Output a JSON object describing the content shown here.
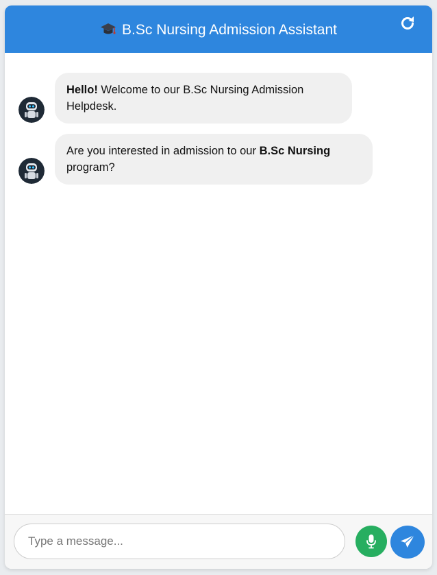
{
  "header": {
    "title": "B.Sc Nursing Admission Assistant",
    "title_icon": "graduation-cap-icon",
    "refresh_icon": "refresh-icon",
    "background_color": "#2e86de"
  },
  "messages": [
    {
      "sender": "bot",
      "avatar_icon": "robot-avatar-icon",
      "parts": [
        {
          "text": "Hello!",
          "bold": true
        },
        {
          "text": " Welcome to our B.Sc Nursing Admission Helpdesk.",
          "bold": false
        }
      ]
    },
    {
      "sender": "bot",
      "avatar_icon": "robot-avatar-icon",
      "parts": [
        {
          "text": "Are you interested in admission to our ",
          "bold": false
        },
        {
          "text": "B.Sc Nursing",
          "bold": true
        },
        {
          "text": " program?",
          "bold": false
        }
      ]
    }
  ],
  "input": {
    "placeholder": "Type a message...",
    "value": "",
    "mic_icon": "microphone-icon",
    "mic_color": "#27ae60",
    "send_icon": "paper-plane-icon",
    "send_color": "#2e86de"
  }
}
